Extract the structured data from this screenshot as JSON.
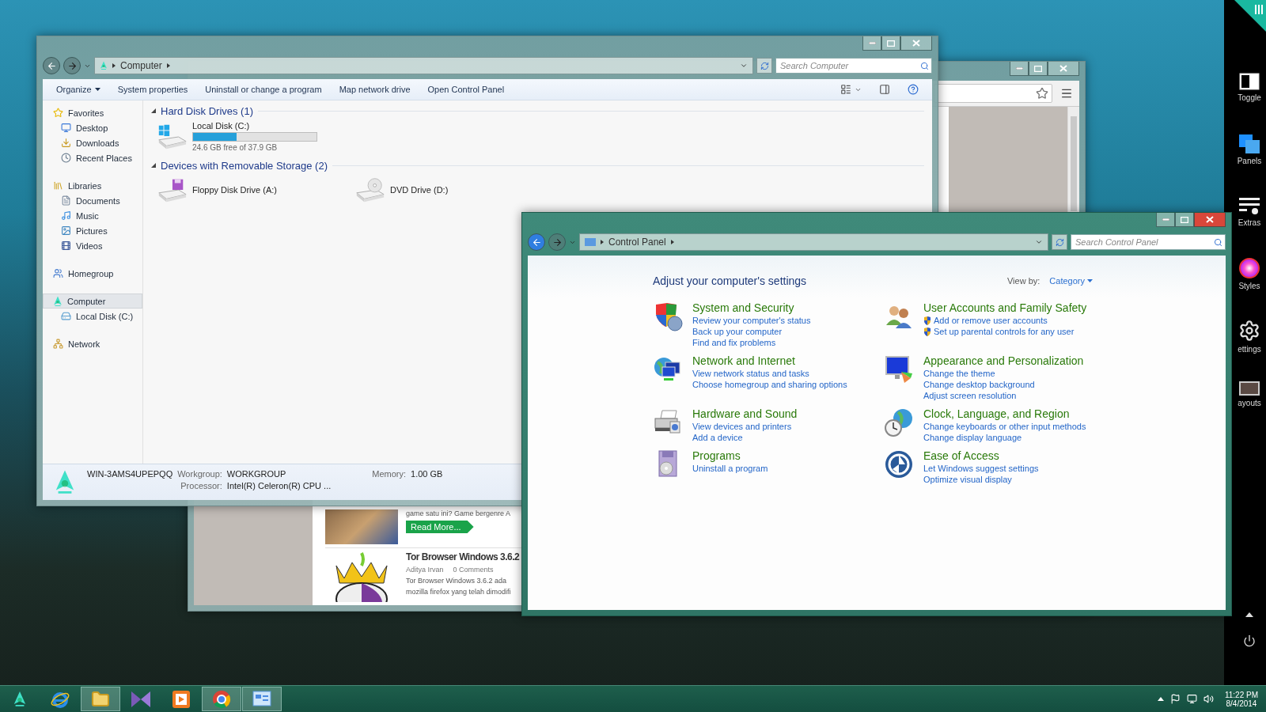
{
  "explorer": {
    "active": false,
    "breadcrumb": "Computer",
    "search": {
      "placeholder": "Search Computer"
    },
    "toolbar": [
      {
        "label": "Organize",
        "kind": "menu"
      },
      {
        "label": "System properties",
        "kind": "action"
      },
      {
        "label": "Uninstall or change a program",
        "kind": "action"
      },
      {
        "label": "Map network drive",
        "kind": "action"
      },
      {
        "label": "Open Control Panel",
        "kind": "action"
      }
    ],
    "nav": [
      {
        "label": "Favorites",
        "kind": "favorites",
        "selected": false,
        "children": [
          {
            "label": "Desktop",
            "kind": "desktop",
            "selected": false
          },
          {
            "label": "Downloads",
            "kind": "downloads",
            "selected": false
          },
          {
            "label": "Recent Places",
            "kind": "recent",
            "selected": false
          }
        ]
      },
      {
        "label": "Libraries",
        "kind": "libraries",
        "selected": false,
        "children": [
          {
            "label": "Documents",
            "kind": "documents",
            "selected": false
          },
          {
            "label": "Music",
            "kind": "music",
            "selected": false
          },
          {
            "label": "Pictures",
            "kind": "pictures",
            "selected": false
          },
          {
            "label": "Videos",
            "kind": "videos",
            "selected": false
          }
        ]
      },
      {
        "label": "Homegroup",
        "kind": "homegroup",
        "selected": false
      },
      {
        "label": "Computer",
        "kind": "computer",
        "selected": true,
        "children": [
          {
            "label": "Local Disk (C:)",
            "kind": "disk",
            "selected": false
          }
        ]
      },
      {
        "label": "Network",
        "kind": "network",
        "selected": false
      }
    ],
    "sections": [
      {
        "title": "Hard Disk Drives (1)",
        "items": [
          {
            "name": "Local Disk (C:)",
            "kind": "system",
            "level": 0.35,
            "free": "24.6 GB free of 37.9 GB"
          }
        ]
      },
      {
        "title": "Devices with Removable Storage (2)",
        "items": [
          {
            "name": "Floppy Disk Drive (A:)",
            "kind": "floppy"
          },
          {
            "name": "DVD Drive (D:)",
            "kind": "dvd"
          }
        ]
      }
    ],
    "details": {
      "computer_name": "WIN-3AMS4UPEPQQ",
      "fields": [
        {
          "label": "Workgroup:",
          "value": "WORKGROUP"
        },
        {
          "label": "Memory:",
          "value": "1.00 GB"
        },
        {
          "label": "Processor:",
          "value": "Intel(R) Celeron(R) CPU ..."
        }
      ]
    }
  },
  "browser": {
    "active": false,
    "articles": [
      {
        "kind": "photo",
        "excerpt": [
          "game satu ini? Game bergenre A"
        ],
        "button": "Read More..."
      },
      {
        "kind": "logo",
        "title": "Tor Browser Windows 3.6.2",
        "author": "Aditya Irvan",
        "comments": "0 Comments",
        "excerpt": [
          "Tor Browser Windows 3.6.2 ada",
          "mozilla firefox yang telah dimodifi"
        ]
      }
    ]
  },
  "control_panel": {
    "active": true,
    "breadcrumb": "Control Panel",
    "search": {
      "placeholder": "Search Control Panel"
    },
    "heading": "Adjust your computer's settings",
    "view_by": {
      "label": "View by:",
      "value": "Category"
    },
    "categories": [
      {
        "title": "System and Security",
        "kind": "security",
        "links": [
          {
            "text": "Review your computer's status",
            "shield": false
          },
          {
            "text": "Back up your computer",
            "shield": false
          },
          {
            "text": "Find and fix problems",
            "shield": false
          }
        ]
      },
      {
        "title": "User Accounts and Family Safety",
        "kind": "users",
        "links": [
          {
            "text": "Add or remove user accounts",
            "shield": true
          },
          {
            "text": "Set up parental controls for any user",
            "shield": true
          }
        ]
      },
      {
        "title": "Network and Internet",
        "kind": "network",
        "links": [
          {
            "text": "View network status and tasks",
            "shield": false
          },
          {
            "text": "Choose homegroup and sharing options",
            "shield": false
          }
        ]
      },
      {
        "title": "Appearance and Personalization",
        "kind": "appearance",
        "links": [
          {
            "text": "Change the theme",
            "shield": false
          },
          {
            "text": "Change desktop background",
            "shield": false
          },
          {
            "text": "Adjust screen resolution",
            "shield": false
          }
        ]
      },
      {
        "title": "Hardware and Sound",
        "kind": "hardware",
        "links": [
          {
            "text": "View devices and printers",
            "shield": false
          },
          {
            "text": "Add a device",
            "shield": false
          }
        ]
      },
      {
        "title": "Clock, Language, and Region",
        "kind": "clock",
        "links": [
          {
            "text": "Change keyboards or other input methods",
            "shield": false
          },
          {
            "text": "Change display language",
            "shield": false
          }
        ]
      },
      {
        "title": "Programs",
        "kind": "programs",
        "links": [
          {
            "text": "Uninstall a program",
            "shield": false
          }
        ]
      },
      {
        "title": "Ease of Access",
        "kind": "access",
        "links": [
          {
            "text": "Let Windows suggest settings",
            "shield": false
          },
          {
            "text": "Optimize visual display",
            "shield": false
          }
        ]
      }
    ]
  },
  "sidebar": [
    {
      "label": "Toggle",
      "kind": "toggle"
    },
    {
      "label": "Panels",
      "kind": "panels"
    },
    {
      "label": "Extras",
      "kind": "extras"
    },
    {
      "label": "Styles",
      "kind": "styles"
    },
    {
      "label": "ettings",
      "kind": "settings"
    },
    {
      "label": "ayouts",
      "kind": "layouts"
    }
  ],
  "taskbar": {
    "apps": [
      {
        "kind": "emblem",
        "running": false
      },
      {
        "kind": "ie",
        "running": false
      },
      {
        "kind": "folder",
        "running": true
      },
      {
        "kind": "bowtie",
        "running": false
      },
      {
        "kind": "media",
        "running": false
      },
      {
        "kind": "chrome",
        "running": true
      },
      {
        "kind": "panel",
        "running": true
      }
    ],
    "clock": {
      "time": "11:22 PM",
      "date": "8/4/2014"
    }
  }
}
